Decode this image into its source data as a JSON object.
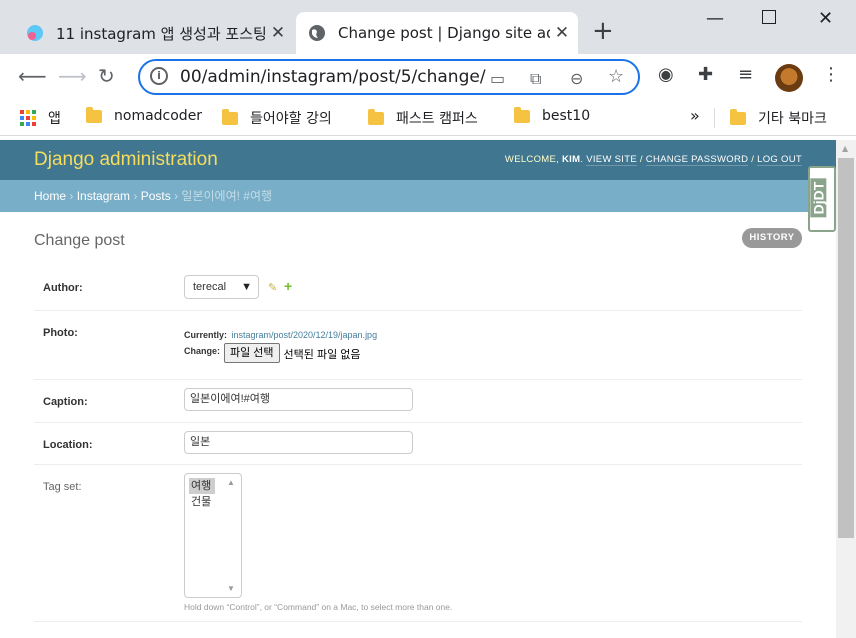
{
  "browser": {
    "tabs": [
      {
        "title": "11 instagram 앱 생성과 포스팅",
        "active": false
      },
      {
        "title": "Change post | Django site ad",
        "active": true
      }
    ],
    "address": "00/admin/instagram/post/5/change/",
    "bookmarks": [
      "앱",
      "nomadcoder",
      "들어야할 강의",
      "패스트 캠퍼스",
      "best10"
    ],
    "other_bookmarks": "기타 북마크",
    "more": "»"
  },
  "admin": {
    "brand": "Django administration",
    "welcome": "WELCOME,",
    "user": "KIM",
    "view_site": "VIEW SITE",
    "change_password": "CHANGE PASSWORD",
    "log_out": "LOG OUT",
    "breadcrumbs": {
      "home": "Home",
      "app": "Instagram",
      "model": "Posts",
      "current": "일본이에여! #여행"
    },
    "title": "Change post",
    "history": "HISTORY",
    "djdt": "DjDT"
  },
  "form": {
    "author_label": "Author:",
    "author_value": "terecal",
    "photo_label": "Photo:",
    "currently_label": "Currently:",
    "currently_link": "instagram/post/2020/12/19/japan.jpg",
    "change_label": "Change:",
    "file_button": "파일 선택",
    "file_status": "선택된 파일 없음",
    "caption_label": "Caption:",
    "caption_value": "일본이에여!#여행",
    "location_label": "Location:",
    "location_value": "일본",
    "tagset_label": "Tag set:",
    "tags": [
      "여행",
      "건물"
    ],
    "help": "Hold down “Control”, or “Command” on a Mac, to select more than one."
  }
}
